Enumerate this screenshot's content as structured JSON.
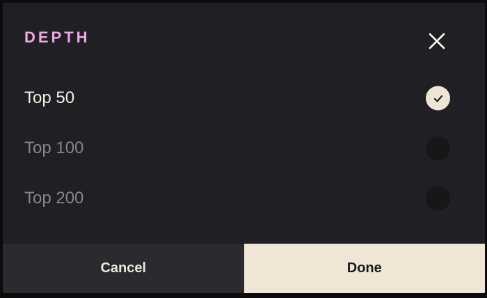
{
  "dialog": {
    "title": "DEPTH",
    "close_icon": "close-icon",
    "options": [
      {
        "label": "Top 50",
        "selected": true
      },
      {
        "label": "Top 100",
        "selected": false
      },
      {
        "label": "Top 200",
        "selected": false
      }
    ],
    "check_icon": "checkmark-icon",
    "cancel_label": "Cancel",
    "done_label": "Done"
  },
  "colors": {
    "background": "#202024",
    "title": "#f2a6e4",
    "selected_text": "#f4efe4",
    "unselected_text": "#85858a",
    "radio_selected": "#efe5d4",
    "radio_unselected": "#17171a",
    "cancel_bg": "#2a2a2f",
    "done_bg": "#efe6d5"
  }
}
